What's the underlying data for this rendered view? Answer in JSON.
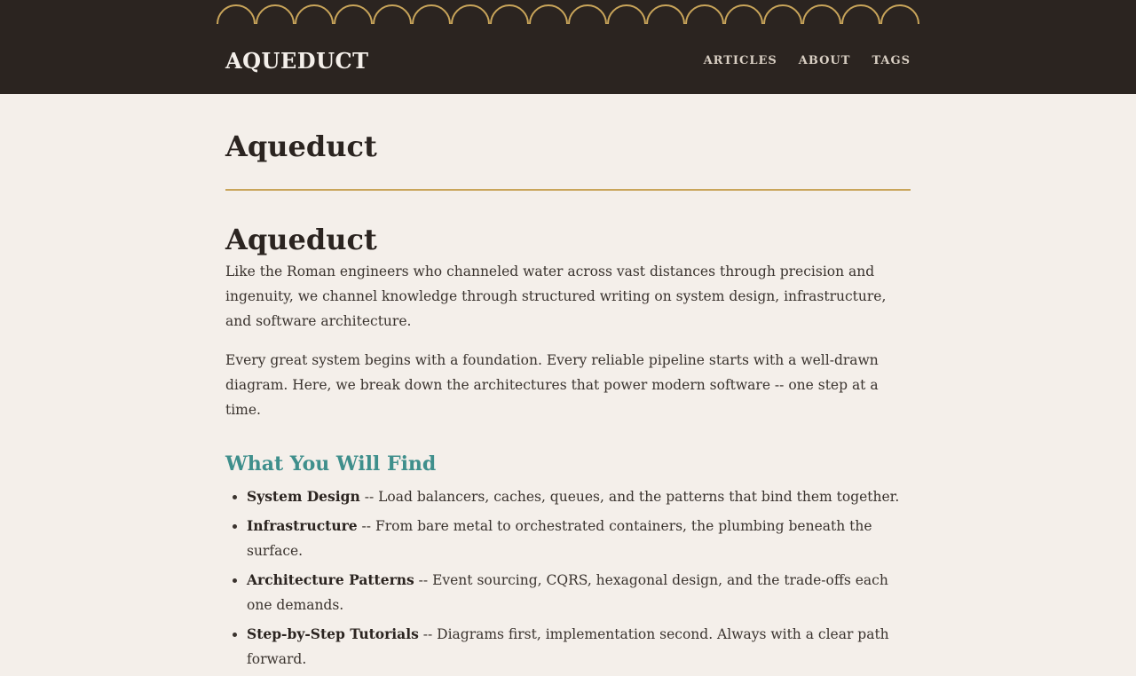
{
  "header": {
    "logo": "AQUEDUCT",
    "nav": [
      {
        "label": "ARTICLES"
      },
      {
        "label": "ABOUT"
      },
      {
        "label": "TAGS"
      }
    ]
  },
  "page": {
    "title": "Aqueduct"
  },
  "content": {
    "heading": "Aqueduct",
    "intro": "Like the Roman engineers who channeled water across vast distances through precision and ingenuity, we channel knowledge through structured writing on system design, infrastructure, and software architecture.",
    "paragraph2": "Every great system begins with a foundation. Every reliable pipeline starts with a well-drawn diagram. Here, we break down the architectures that power modern software -- one step at a time.",
    "section_title": "What You Will Find",
    "features": [
      {
        "title": "System Design",
        "description": " -- Load balancers, caches, queues, and the patterns that bind them together."
      },
      {
        "title": "Infrastructure",
        "description": " -- From bare metal to orchestrated containers, the plumbing beneath the surface."
      },
      {
        "title": "Architecture Patterns",
        "description": " -- Event sourcing, CQRS, hexagonal design, and the trade-offs each one demands."
      },
      {
        "title": "Step-by-Step Tutorials",
        "description": " -- Diagrams first, implementation second. Always with a clear path forward."
      }
    ]
  },
  "colors": {
    "header_bg": "#2b2420",
    "page_bg": "#f4efea",
    "accent_gold": "#c9a55a",
    "accent_teal": "#3f8f8c"
  },
  "icons": [
    "arch-decoration"
  ]
}
